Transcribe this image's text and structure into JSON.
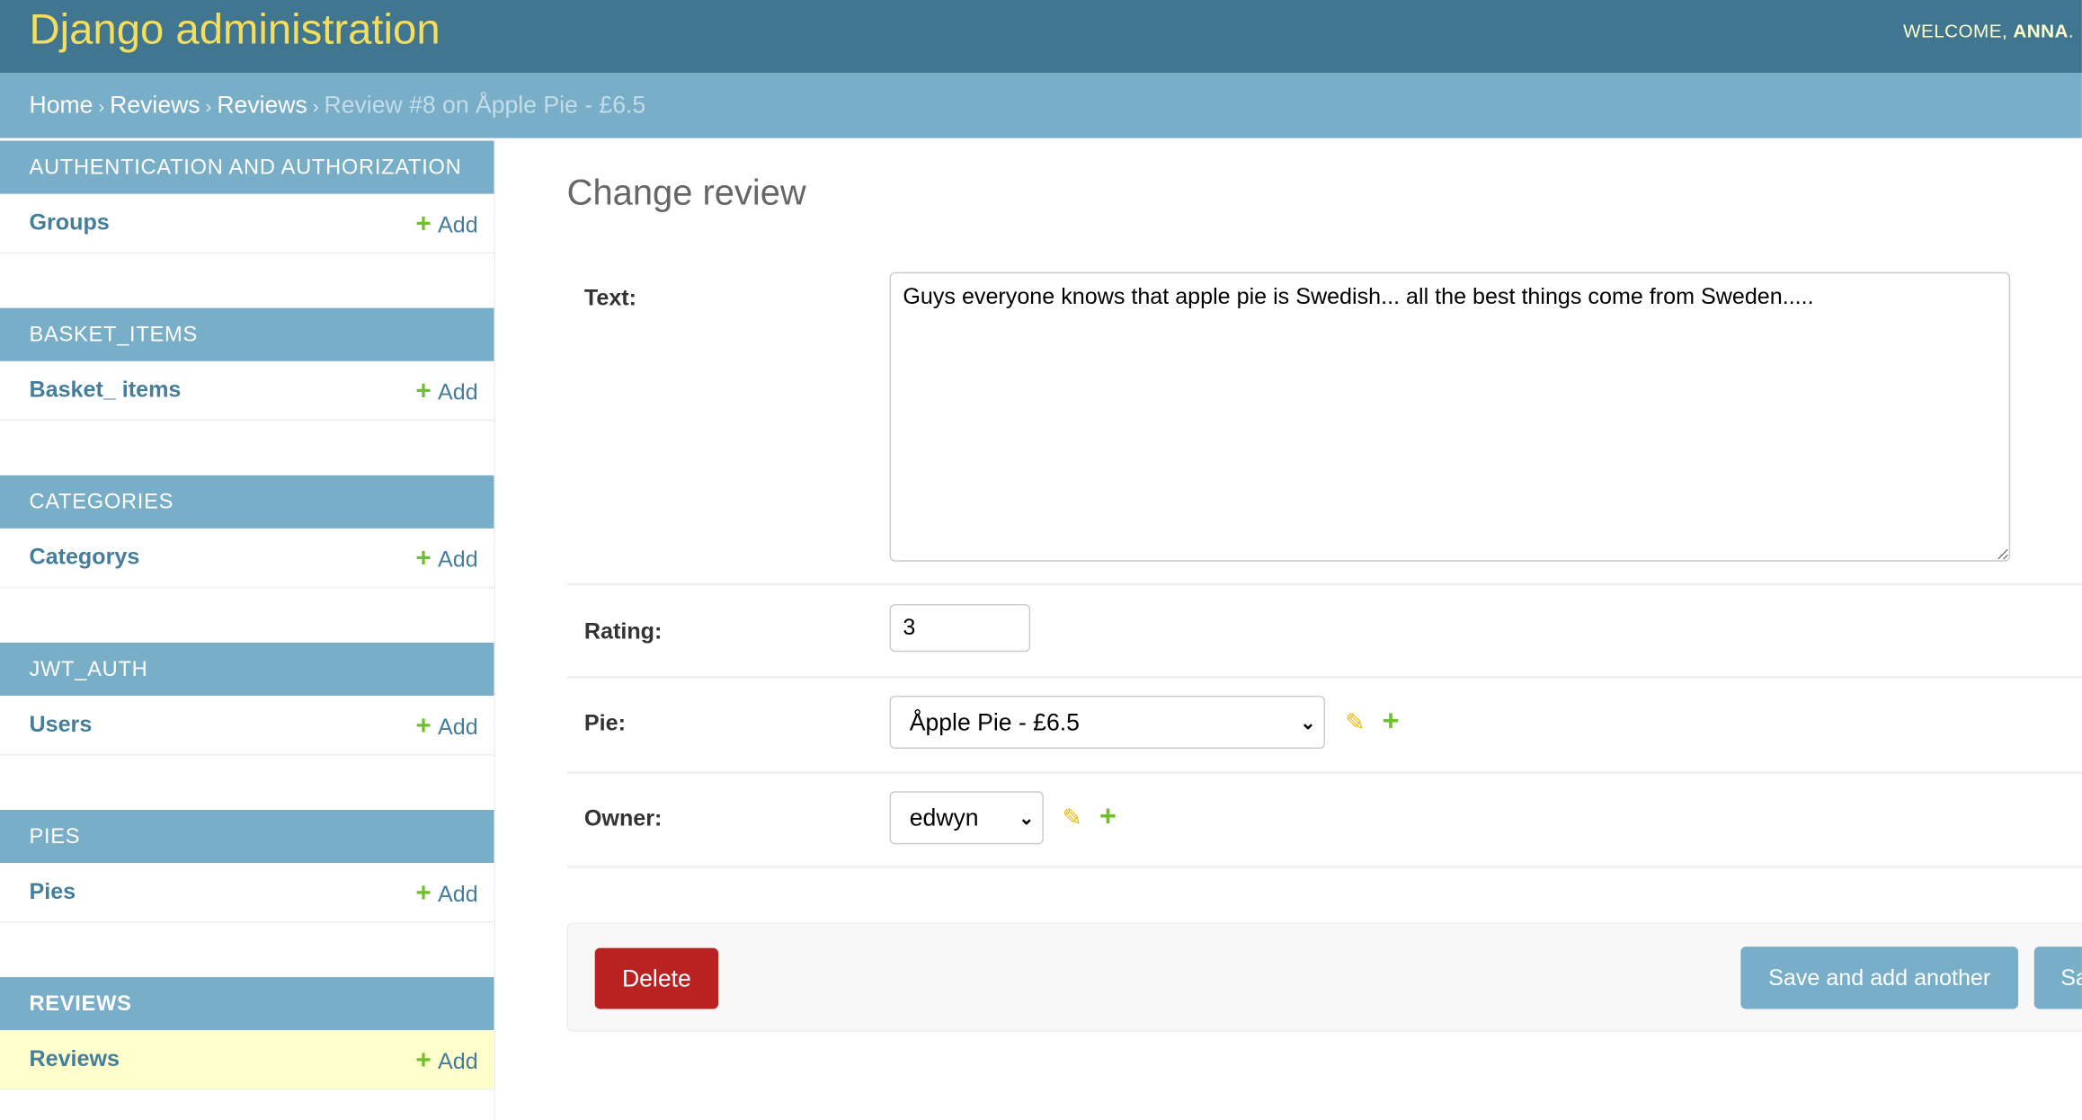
{
  "header": {
    "title": "Django administration",
    "welcome": "WELCOME, ",
    "user": "ANNA",
    "welcome_tail": ". "
  },
  "breadcrumbs": [
    "Home",
    "Reviews",
    "Reviews",
    "Review #8 on Åpple Pie - £6.5"
  ],
  "breadcrumb_sep": "›",
  "sidebar": {
    "modules": [
      {
        "caption": "AUTHENTICATION AND AUTHORIZATION",
        "item": "Groups",
        "add": "Add"
      },
      {
        "caption": "BASKET_ITEMS",
        "item": "Basket_ items",
        "add": "Add"
      },
      {
        "caption": "CATEGORIES",
        "item": "Categorys",
        "add": "Add"
      },
      {
        "caption": "JWT_AUTH",
        "item": "Users",
        "add": "Add"
      },
      {
        "caption": "PIES",
        "item": "Pies",
        "add": "Add"
      },
      {
        "caption": "REVIEWS",
        "item": "Reviews",
        "add": "Add",
        "active": true
      }
    ]
  },
  "form": {
    "title": "Change review",
    "text_label": "Text:",
    "text_value": "Guys everyone knows that apple pie is Swedish... all the best things come from Sweden.....",
    "rating_label": "Rating:",
    "rating_value": "3",
    "pie_label": "Pie:",
    "pie_value": "Åpple Pie - £6.5",
    "owner_label": "Owner:",
    "owner_value": "edwyn"
  },
  "actions": {
    "delete": "Delete",
    "save_add_another": "Save and add another",
    "save_continue": "Sa"
  },
  "colors": {
    "header": "#417690",
    "breadcrumb": "#79aec8",
    "brand": "#f5dd5d",
    "delete": "#ba2121",
    "add_green": "#70bf2b"
  }
}
